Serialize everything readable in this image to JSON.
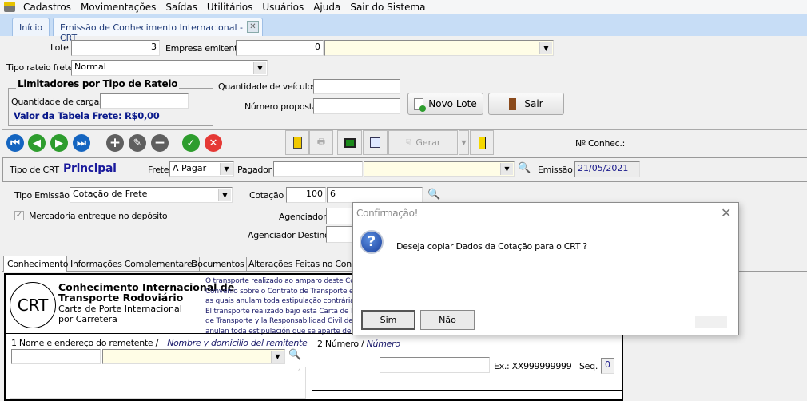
{
  "menu": [
    "Cadastros",
    "Movimentações",
    "Saídas",
    "Utilitários",
    "Usuários",
    "Ajuda",
    "Sair do Sistema"
  ],
  "tabs": {
    "home": "Início",
    "crt": "Emissão de Conhecimento Internacional - CRT"
  },
  "header": {
    "lote_label": "Lote",
    "lote_value": "3",
    "empresa_label": "Empresa emitente",
    "empresa_value": "0",
    "empresa_name": "",
    "tipo_rateio_label": "Tipo rateio frete",
    "tipo_rateio_value": "Normal",
    "group_title": "Limitadores por Tipo de Rateio",
    "qtd_cargas_label": "Quantidade de cargas",
    "qtd_cargas_value": "",
    "valor_tabela": "Valor da Tabela Frete: R$0,00",
    "qtd_veiculos_label": "Quantidade de veículos",
    "qtd_veiculos_value": "",
    "num_proposta_label": "Número proposta",
    "num_proposta_value": "",
    "novo_lote": "Novo Lote",
    "sair": "Sair"
  },
  "toolbar": {
    "gerar": "Gerar",
    "conhec_label": "Nº Conhec.:",
    "nav_colors": {
      "blue": "#1565c0",
      "green": "#2e9d2e",
      "gray": "#5f5f5f",
      "red": "#e53935"
    }
  },
  "crt": {
    "tipo_label": "Tipo de CRT",
    "tipo_value": "Principal",
    "frete_label": "Frete",
    "frete_value": "A Pagar",
    "pagador_label": "Pagador",
    "pagador_value": "",
    "emissao_label": "Emissão",
    "emissao_value": "21/05/2021",
    "tipo_emissao_label": "Tipo Emissão",
    "tipo_emissao_value": "Cotação de Frete",
    "cotacao_label": "Cotação",
    "cotacao_value": "100",
    "cotacao_num": "6",
    "mercadoria_label": "Mercadoria entregue no depósito",
    "mercadoria_checked": true,
    "agenciador_label": "Agenciador",
    "agenciador_destino_label": "Agenciador Destino"
  },
  "subtabs": [
    "Conhecimento",
    "Informações Complementares",
    "Documentos",
    "Alterações Feitas no Conhe"
  ],
  "doc": {
    "logo": "CRT",
    "title1": "Conhecimento Internacional de",
    "title2": "Transporte Rodoviário",
    "subtitle1": "Carta  de Porte Internacional",
    "subtitle2": "por Carretera",
    "legal": [
      "O transporte realizado ao amparo deste Con",
      "Convênio sobre o Contrato de Transporte e",
      "as quais anulam toda estipulação contrária à",
      "El transporte realizado bajo esta Carta de Po",
      "de Transporte y la Responsabilidad Civil del",
      "anulan toda estipulación que se aparte de ell"
    ],
    "s1_label": "1 Nome e endereço do remetente /",
    "s1_label_es": "Nombre y domicilio del remitente",
    "s2_label": "2 Número /",
    "s2_label_es": "Número",
    "ex": "Ex.: XX999999999",
    "seq_label": "Seq.",
    "seq_value": "0"
  },
  "dialog": {
    "title": "Confirmação!",
    "message": "Deseja copiar Dados da Cotação para o CRT ?",
    "yes": "Sim",
    "no": "Não"
  }
}
